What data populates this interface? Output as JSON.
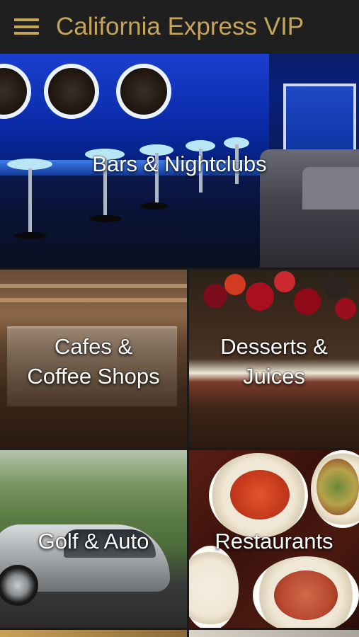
{
  "app": {
    "title": "California Express VIP",
    "accent_color": "#c5a55a"
  },
  "header": {
    "menu_icon": "hamburger-menu-icon"
  },
  "categories": [
    {
      "label": "Bars & Nightclubs"
    },
    {
      "label": "Cafes &\nCoffee Shops"
    },
    {
      "label": "Desserts &\nJuices"
    },
    {
      "label": "Golf & Auto"
    },
    {
      "label": "Restaurants"
    }
  ]
}
